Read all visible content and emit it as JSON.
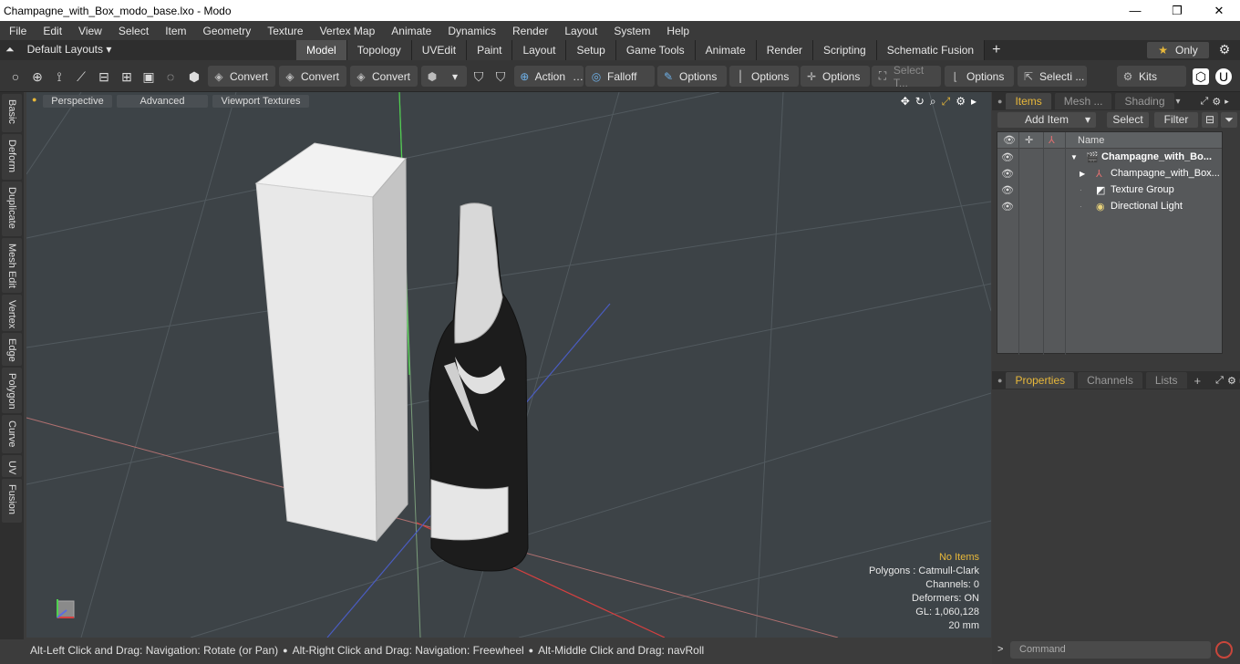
{
  "window": {
    "title": "Champagne_with_Box_modo_base.lxo - Modo",
    "minimize": "—",
    "maximize": "❐",
    "close": "✕"
  },
  "menu": [
    "File",
    "Edit",
    "View",
    "Select",
    "Item",
    "Geometry",
    "Texture",
    "Vertex Map",
    "Animate",
    "Dynamics",
    "Render",
    "Layout",
    "System",
    "Help"
  ],
  "layouts": {
    "label": "Default Layouts ▾"
  },
  "tabs": [
    "Model",
    "Topology",
    "UVEdit",
    "Paint",
    "Layout",
    "Setup",
    "Game Tools",
    "Animate",
    "Render",
    "Scripting",
    "Schematic Fusion"
  ],
  "active_tab": "Model",
  "only_button": "Only",
  "toolbar": {
    "convert1": "Convert",
    "convert2": "Convert",
    "convert3": "Convert",
    "action": "Action",
    "action_more": "…",
    "falloff": "Falloff",
    "options1": "Options",
    "options2": "Options",
    "options3": "Options",
    "select_t": "Select T...",
    "options4": "Options",
    "selecti": "Selecti ...",
    "kits": "Kits"
  },
  "left_tabs": [
    "Basic",
    "Deform",
    "Duplicate",
    "Mesh Edit",
    "Vertex",
    "Edge",
    "Polygon",
    "Curve",
    "UV",
    "Fusion"
  ],
  "viewport": {
    "perspective": "Perspective",
    "advanced": "Advanced",
    "textures": "Viewport Textures",
    "stats": {
      "no_items": "No Items",
      "polygons": "Polygons : Catmull-Clark",
      "channels": "Channels: 0",
      "deformers": "Deformers: ON",
      "gl": "GL: 1,060,128",
      "scale": "20 mm"
    }
  },
  "items_panel": {
    "tabs": [
      "Items",
      "Mesh ...",
      "Shading"
    ],
    "add_item": "Add Item",
    "select": "Select",
    "filter": "Filter",
    "column_name": "Name",
    "rows": [
      {
        "label": "Champagne_with_Bo...",
        "bold": true
      },
      {
        "label": "Champagne_with_Box..."
      },
      {
        "label": "Texture Group"
      },
      {
        "label": "Directional Light"
      }
    ]
  },
  "properties_panel": {
    "tabs": [
      "Properties",
      "Channels",
      "Lists"
    ]
  },
  "status": {
    "hint1": "Alt-Left Click and Drag: Navigation: Rotate (or Pan)",
    "hint2": "Alt-Right Click and Drag: Navigation: Freewheel",
    "hint3": "Alt-Middle Click and Drag: navRoll"
  },
  "command": {
    "placeholder": "Command",
    "arrow": ">"
  }
}
